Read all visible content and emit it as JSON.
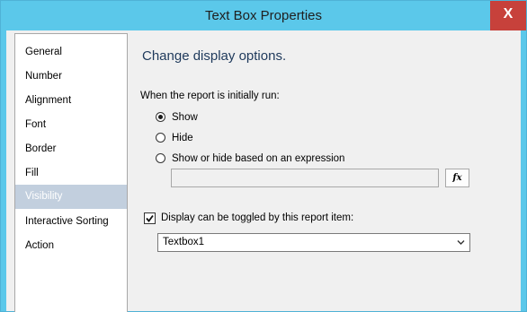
{
  "window": {
    "title": "Text Box Properties",
    "close_glyph": "X"
  },
  "nav": {
    "items": [
      {
        "label": "General"
      },
      {
        "label": "Number"
      },
      {
        "label": "Alignment"
      },
      {
        "label": "Font"
      },
      {
        "label": "Border"
      },
      {
        "label": "Fill"
      },
      {
        "label": "Visibility",
        "selected": true
      },
      {
        "label": "Interactive Sorting"
      },
      {
        "label": "Action"
      }
    ]
  },
  "main": {
    "heading": "Change display options.",
    "initial_label": "When the report is initially run:",
    "options": [
      {
        "label": "Show",
        "checked": true
      },
      {
        "label": "Hide",
        "checked": false
      },
      {
        "label": "Show or hide based on an expression",
        "checked": false
      }
    ],
    "expression_value": "",
    "fx_label": "fx",
    "toggle_checkbox_label": "Display can be toggled by this report item:",
    "toggle_checked": true,
    "toggle_item_value": "Textbox1"
  },
  "colors": {
    "titlebar": "#5bc8ea",
    "close": "#c7413b",
    "selected_nav": "#c2cfde",
    "heading": "#1e395b"
  },
  "icons": [
    "close-icon",
    "fx-icon",
    "checkmark-icon",
    "chevron-down-icon"
  ]
}
